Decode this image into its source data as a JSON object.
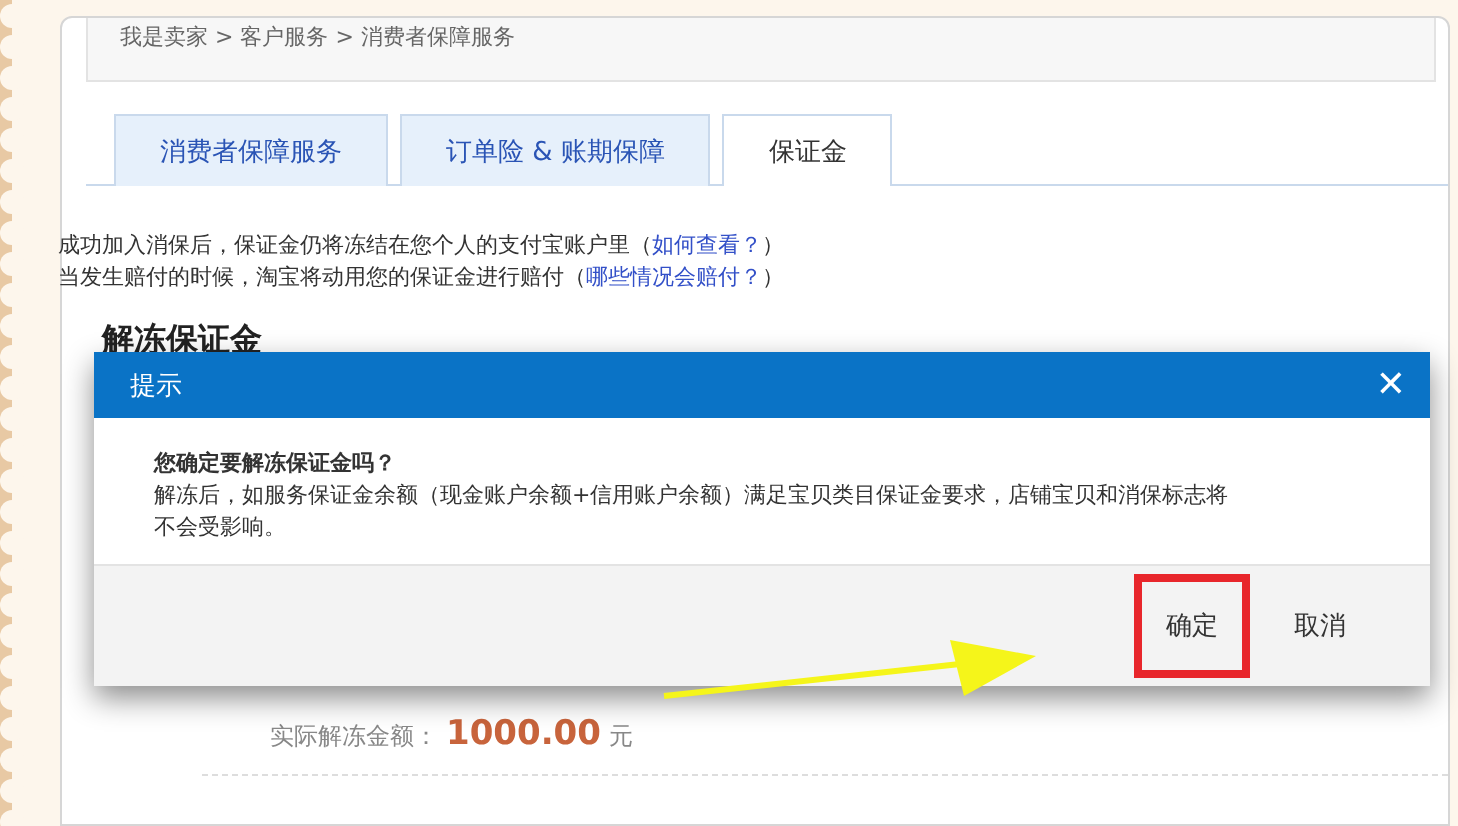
{
  "breadcrumb": "我是卖家 > 客户服务 > 消费者保障服务",
  "tabs": [
    {
      "label": "消费者保障服务",
      "selected": false
    },
    {
      "label": "订单险 & 账期保障",
      "selected": false
    },
    {
      "label": "保证金",
      "selected": true
    }
  ],
  "notes": [
    {
      "text": "成功加入消保后，保证金仍将冻结在您个人的支付宝账户里（",
      "link": "如何查看？",
      "end": "）"
    },
    {
      "text": "当发生赔付的时候，淘宝将动用您的保证金进行赔付（",
      "link": "哪些情况会赔付？",
      "end": "）"
    }
  ],
  "section_title": "解冻保证金",
  "amount": {
    "label": "实际解冻金额：",
    "value": "1000.00",
    "unit": "元"
  },
  "dialog": {
    "title": "提示",
    "close": "✕",
    "question": "您确定要解冻保证金吗？",
    "message": "解冻后，如服务保证金余额（现金账户余额+信用账户余额）满足宝贝类目保证金要求，店铺宝贝和消保标志将不会受影响。",
    "buttons": [
      {
        "label": "确定",
        "highlighted": true
      },
      {
        "label": "取消",
        "highlighted": false
      }
    ]
  }
}
